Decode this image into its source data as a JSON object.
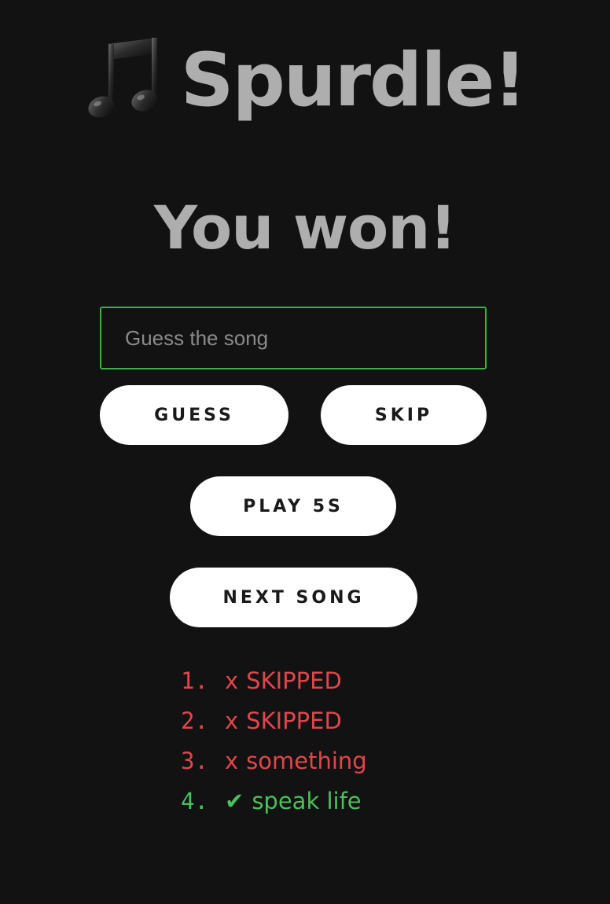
{
  "app": {
    "title": "Spurdle!",
    "title_icon": "music-notes-icon"
  },
  "status_text": "You won!",
  "guess_input": {
    "placeholder": "Guess the song",
    "value": ""
  },
  "buttons": {
    "guess": "GUESS",
    "skip": "SKIP",
    "play": "PLAY 5S",
    "next": "NEXT SONG"
  },
  "history": [
    {
      "num": "1.",
      "mark": "x",
      "text": "SKIPPED",
      "status": "wrong"
    },
    {
      "num": "2.",
      "mark": "x",
      "text": "SKIPPED",
      "status": "wrong"
    },
    {
      "num": "3.",
      "mark": "x",
      "text": "something",
      "status": "wrong"
    },
    {
      "num": "4.",
      "mark": "✔",
      "text": "speak life",
      "status": "correct"
    }
  ],
  "colors": {
    "background": "#121212",
    "input_border": "#3fae49",
    "wrong": "#e0464b",
    "correct": "#4bbf5a",
    "button_bg": "#ffffff"
  }
}
